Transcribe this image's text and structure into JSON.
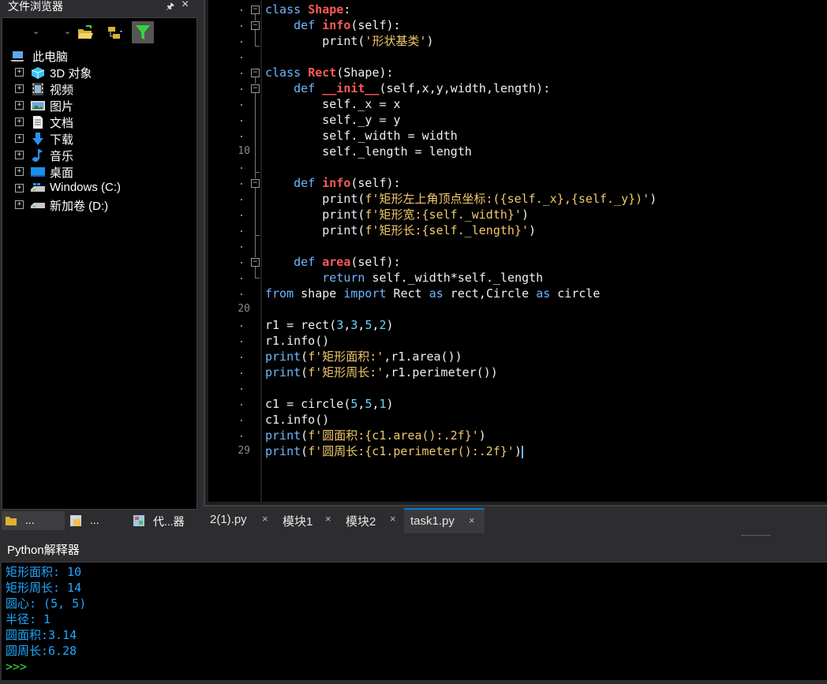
{
  "file_browser": {
    "title": "文件浏览器",
    "pin_icon": "pin-icon",
    "close_glyph": "×",
    "tree": [
      {
        "label": "此电脑",
        "icon": "computer-icon",
        "expander": ""
      },
      {
        "label": "3D 对象",
        "icon": "cube-icon",
        "expander": "+"
      },
      {
        "label": "视频",
        "icon": "film-icon",
        "expander": "+"
      },
      {
        "label": "图片",
        "icon": "picture-icon",
        "expander": "+"
      },
      {
        "label": "文档",
        "icon": "document-icon",
        "expander": "+"
      },
      {
        "label": "下载",
        "icon": "download-arrow-icon",
        "expander": "+"
      },
      {
        "label": "音乐",
        "icon": "music-note-icon",
        "expander": "+"
      },
      {
        "label": "桌面",
        "icon": "desktop-icon",
        "expander": "+"
      },
      {
        "label": "Windows (C:)",
        "icon": "drive-icon",
        "expander": "+"
      },
      {
        "label": "新加卷 (D:)",
        "icon": "drive-icon",
        "expander": "+"
      }
    ],
    "tabs": [
      {
        "label": "...",
        "icon": "folder-icon"
      },
      {
        "label": "...",
        "icon": "module-icon"
      },
      {
        "label": "代...器",
        "icon": "code-view-icon"
      }
    ]
  },
  "editor": {
    "line_numbers": [
      "10",
      "20",
      "29"
    ],
    "tabs": [
      {
        "label": "2(1).py",
        "close": "×"
      },
      {
        "label": "模块1",
        "close": "×"
      },
      {
        "label": "模块2",
        "close": "×"
      },
      {
        "label": "task1.py",
        "close": "×",
        "active": true
      }
    ]
  },
  "interpreter": {
    "title": "Python解释器",
    "output": [
      "矩形面积: 10",
      "矩形周长: 14",
      "圆心: (5, 5)",
      "半径: 1",
      "圆面积:3.14",
      "圆周长:6.28"
    ],
    "prompt": ">>>"
  },
  "colors": {
    "background": "#000000",
    "keyword": "#6fb7ff",
    "class_name": "#ff5a5a",
    "string": "#f1c96a",
    "output_text": "#1fa8ff",
    "prompt": "#3fd43f"
  }
}
